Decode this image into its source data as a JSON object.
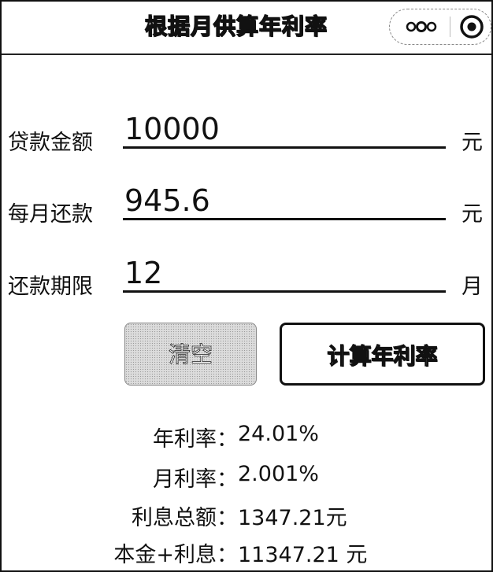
{
  "app": {
    "title": "根据月供算年利率"
  },
  "form": {
    "loan_amount": {
      "label": "贷款金额",
      "value": "10000",
      "unit": "元"
    },
    "monthly_payment": {
      "label": "每月还款",
      "value": "945.6",
      "unit": "元"
    },
    "term": {
      "label": "还款期限",
      "value": "12",
      "unit": "月"
    }
  },
  "buttons": {
    "clear_label": "清空",
    "calc_label": "计算年利率"
  },
  "results": [
    {
      "label": "年利率：",
      "value": "24.01%"
    },
    {
      "label": "月利率：",
      "value": "2.001%"
    },
    {
      "label": "利息总额：",
      "value": "1347.21元"
    },
    {
      "label": "本金+利息：",
      "value": "11347.21 元"
    }
  ],
  "icons": {
    "capsule_left": "more-dots-icon",
    "capsule_right": "close-target-icon"
  }
}
